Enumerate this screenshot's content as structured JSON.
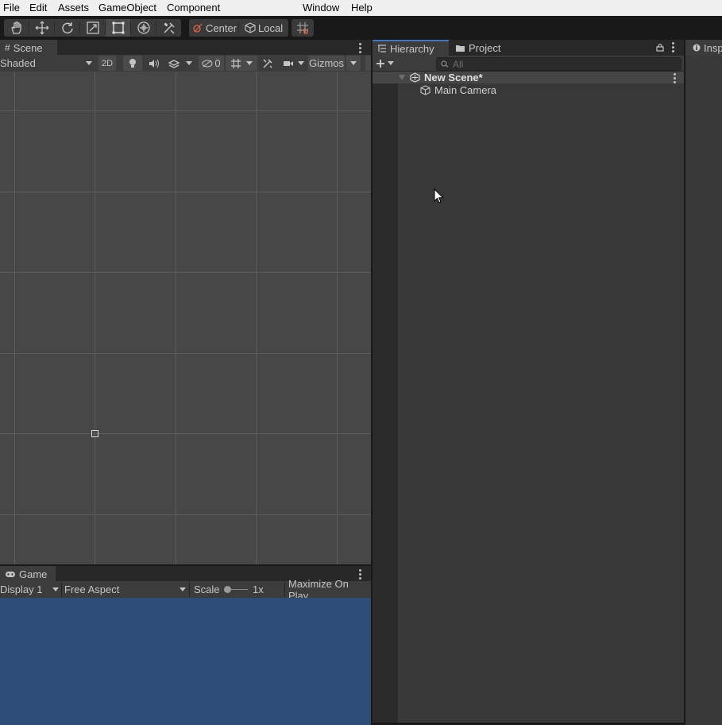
{
  "menu": [
    "File",
    "Edit",
    "Assets",
    "GameObject",
    "Component",
    "Window",
    "Help"
  ],
  "toolbar": {
    "tools": [
      {
        "name": "hand-tool-icon",
        "active": false
      },
      {
        "name": "move-tool-icon",
        "active": false
      },
      {
        "name": "rotate-tool-icon",
        "active": false
      },
      {
        "name": "scale-tool-icon",
        "active": false
      },
      {
        "name": "rect-tool-icon",
        "active": true
      },
      {
        "name": "transform-tool-icon",
        "active": false
      },
      {
        "name": "custom-tool-icon",
        "active": false
      }
    ],
    "pivot_position": "Center",
    "pivot_rotation": "Local",
    "snap_icon": "grid-snap-icon"
  },
  "scene": {
    "tab_label": "Scene",
    "tab_icon": "grid-hash-icon",
    "shading_mode": "Shaded",
    "mode_2d": "2D",
    "hidden_count": "0",
    "gizmos_label": "Gizmos"
  },
  "game": {
    "tab_label": "Game",
    "tab_icon": "gamepad-icon",
    "display": "Display 1",
    "aspect": "Free Aspect",
    "scale_label": "Scale",
    "scale_value": "1x",
    "maximize_label": "Maximize On Play"
  },
  "hierarchy": {
    "tab_label": "Hierarchy",
    "project_tab_label": "Project",
    "search_placeholder": "All",
    "scene_name": "New Scene*",
    "items": [
      "Main Camera"
    ]
  },
  "inspector": {
    "tab_label": "Insp"
  },
  "colors": {
    "game_background": "#2f4d79",
    "active_tab_accent": "#3a79bb",
    "menubar": "#f0f0f0"
  }
}
